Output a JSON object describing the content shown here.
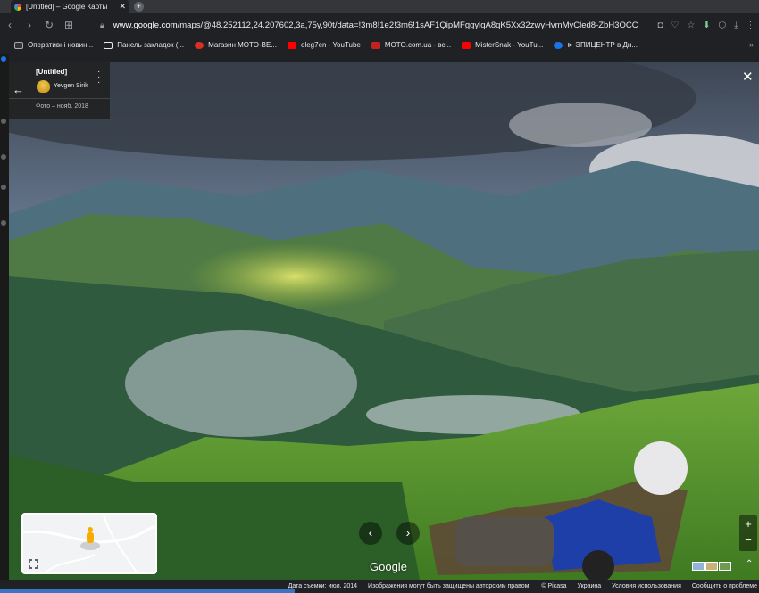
{
  "browser": {
    "tab_title": "[Untitled] – Google Карты",
    "url_host": "www.google.com",
    "url_path": "/maps/@48.252112,24.207602,3a,75y,90t/data=!3m8!1e2!3m6!1sAF1QipMFggylqA8qK5Xx32zwyHvmMyCled8-ZbH3OCC",
    "bookmarks": [
      {
        "label": "Оперативні новин...",
        "icon_color": "#ffffff"
      },
      {
        "label": "Панель закладок (...",
        "icon_color": "#e8eaed"
      },
      {
        "label": "Магазин MOTO-BE...",
        "icon_color": "#d93025"
      },
      {
        "label": "oleg7en - YouTube",
        "icon_color": "#ff0000"
      },
      {
        "label": "MOTO.com.ua - вс...",
        "icon_color": "#c5221f"
      },
      {
        "label": "MisterSnak - YouTu...",
        "icon_color": "#ff0000"
      },
      {
        "label": "⊳ ЭПИЦЕНТР в Дн...",
        "icon_color": "#1a73e8"
      }
    ]
  },
  "photo_card": {
    "title": "[Untitled]",
    "author": "Yevgen Sirik",
    "date": "Фото – нояб. 2018"
  },
  "map": {
    "logo": "Google"
  },
  "footer": {
    "capture_date": "Дата съемки: июл. 2014",
    "copyright": "Изображения могут быть защищены авторским правом.",
    "picasa": "© Picasa",
    "country": "Украина",
    "terms": "Условия использования",
    "report": "Сообщить о проблеме"
  }
}
